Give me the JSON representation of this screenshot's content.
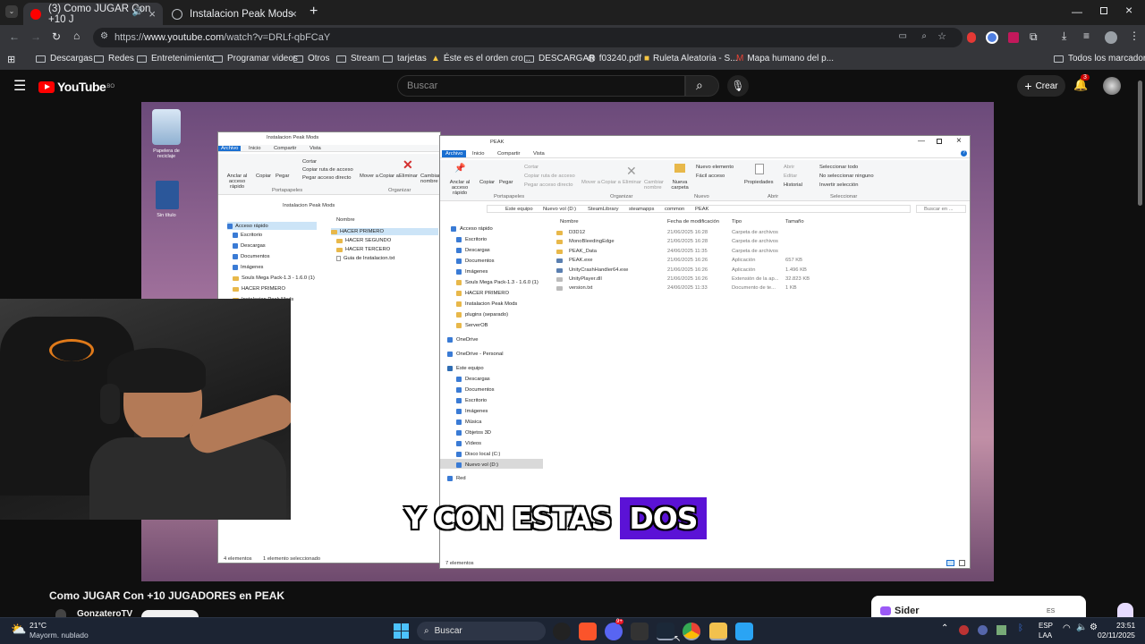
{
  "browser": {
    "tabs": [
      {
        "title": "(3) Como JUGAR Con +10 J",
        "active": true
      },
      {
        "title": "Instalacion Peak Mods",
        "active": false
      }
    ],
    "new_tab": "+",
    "url_prefix": "https://",
    "url_host": "www.youtube.com",
    "url_path": "/watch?v=DRLf-qbFCaY",
    "bookmarks": [
      "Descargas",
      "Redes",
      "Entretenimiento",
      "Programar videos",
      "Otros",
      "Stream",
      "tarjetas",
      "Éste es el orden cro...",
      "DESCARGAR",
      "f03240.pdf",
      "Ruleta Aleatoria - S...",
      "Mapa humano del p..."
    ],
    "all_bookmarks": "Todos los marcadores"
  },
  "youtube": {
    "logo": "YouTube",
    "country": "BO",
    "search_placeholder": "Buscar",
    "create_label": "Crear",
    "notif_count": "3",
    "video_title": "Como JUGAR Con +10 JUGADORES en PEAK",
    "channel": "GonzateroTV",
    "sider": "Sider",
    "sider_lang": "ES"
  },
  "video": {
    "caption_plain": "Y CON ESTAS",
    "caption_highlight": "DOS",
    "desktop_icons": [
      {
        "label": "Papelera de reciclaje"
      },
      {
        "label": "Sin título"
      }
    ],
    "back_window": {
      "title": "Instalacion Peak Mods",
      "tabs": [
        "Archivo",
        "Inicio",
        "Compartir",
        "Vista"
      ],
      "address": "Instalacion Peak Mods",
      "col_name": "Nombre",
      "files": [
        "HACER PRIMERO",
        "HACER SEGUNDO",
        "HACER TERCERO",
        "Guia de Instalacion.txt"
      ],
      "nav": [
        "Acceso rápido",
        "Escritorio",
        "Descargas",
        "Documentos",
        "Imágenes",
        "Souls Mega Pack-1.3 - 1.6.0 (1)",
        "HACER PRIMERO",
        "Instalacion Peak Mods"
      ],
      "status_count": "4 elementos",
      "status_sel": "1 elemento seleccionado",
      "ribbon": [
        "Anclar al acceso rápido",
        "Copiar",
        "Pegar",
        "Mover a",
        "Copiar a",
        "Eliminar",
        "Cambiar nombre"
      ],
      "ribbon_small": [
        "Cortar",
        "Copiar ruta de acceso",
        "Pegar acceso directo"
      ],
      "groups": [
        "Portapapeles",
        "Organizar"
      ]
    },
    "front_window": {
      "title": "PEAK",
      "tabs": [
        "Archivo",
        "Inicio",
        "Compartir",
        "Vista"
      ],
      "breadcrumb": [
        "Este equipo",
        "Nuevo vol (D:)",
        "SteamLibrary",
        "steamapps",
        "common",
        "PEAK"
      ],
      "search": "Buscar en ...",
      "columns": [
        "Nombre",
        "Fecha de modificación",
        "Tipo",
        "Tamaño"
      ],
      "files": [
        {
          "name": "D3D12",
          "date": "21/06/2025 16:28",
          "type": "Carpeta de archivos",
          "size": ""
        },
        {
          "name": "MonoBleedingEdge",
          "date": "21/06/2025 16:28",
          "type": "Carpeta de archivos",
          "size": ""
        },
        {
          "name": "PEAK_Data",
          "date": "24/06/2025 11:35",
          "type": "Carpeta de archivos",
          "size": ""
        },
        {
          "name": "PEAK.exe",
          "date": "21/06/2025 16:26",
          "type": "Aplicación",
          "size": "657 KB"
        },
        {
          "name": "UnityCrashHandler64.exe",
          "date": "21/06/2025 16:26",
          "type": "Aplicación",
          "size": "1.496 KB"
        },
        {
          "name": "UnityPlayer.dll",
          "date": "21/06/2025 16:26",
          "type": "Extensión de la ap...",
          "size": "32.823 KB"
        },
        {
          "name": "version.txt",
          "date": "24/06/2025 11:33",
          "type": "Documento de te...",
          "size": "1 KB"
        }
      ],
      "nav": [
        "Acceso rápido",
        "Escritorio",
        "Descargas",
        "Documentos",
        "Imágenes",
        "Souls Mega Pack-1.3 - 1.6.0 (1)",
        "HACER PRIMERO",
        "Instalacion Peak Mods",
        "plugins (separado)",
        "ServerOB",
        "OneDrive",
        "OneDrive - Personal",
        "Este equipo",
        "Descargas",
        "Documentos",
        "Escritorio",
        "Imágenes",
        "Música",
        "Objetos 3D",
        "Vídeos",
        "Disco local (C:)",
        "Nuevo vol (D:)",
        "Red"
      ],
      "status_count": "7 elementos",
      "ribbon_big": [
        "Anclar al acceso rápido",
        "Copiar",
        "Pegar",
        "Mover a",
        "Copiar a",
        "Eliminar",
        "Cambiar nombre",
        "Nueva carpeta",
        "Propiedades"
      ],
      "ribbon_small": [
        "Cortar",
        "Copiar ruta de acceso",
        "Pegar acceso directo",
        "Nuevo elemento",
        "Fácil acceso",
        "Abrir",
        "Editar",
        "Historial",
        "Seleccionar todo",
        "No seleccionar ninguno",
        "Invertir selección"
      ],
      "groups": [
        "Portapapeles",
        "Organizar",
        "Nuevo",
        "Abrir",
        "Seleccionar"
      ]
    }
  },
  "taskbar": {
    "weather_temp": "21°C",
    "weather_desc": "Mayorm. nublado",
    "search": "Buscar",
    "lang": "ESP",
    "lang2": "LAA",
    "time": "23:51",
    "date": "02/11/2025",
    "badge": "9+"
  },
  "colors": {
    "yt_red": "#ff0000",
    "caption_highlight": "#5b12d6",
    "explorer_blue": "#1a6fd1"
  }
}
